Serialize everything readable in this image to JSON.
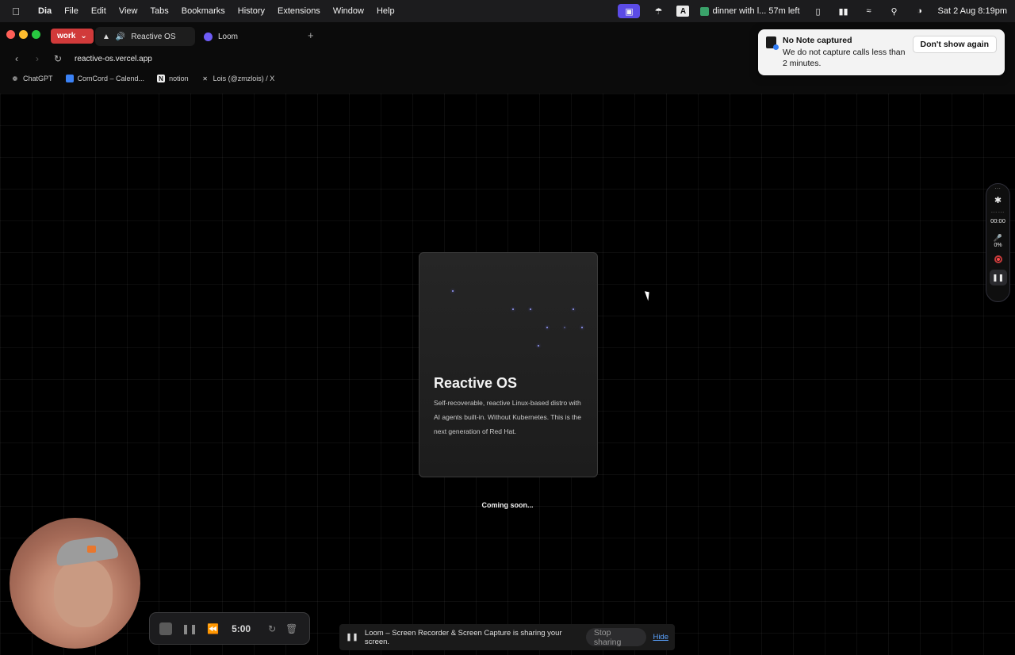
{
  "menubar": {
    "app_name": "Dia",
    "menus": [
      "File",
      "Edit",
      "View",
      "Tabs",
      "Bookmarks",
      "History",
      "Extensions",
      "Window",
      "Help"
    ],
    "calendar_event": "dinner with l... 57m left",
    "datetime": "Sat 2 Aug  8:19pm",
    "input_source": "A"
  },
  "browser": {
    "space": "work",
    "tabs": [
      {
        "title": "Reactive OS",
        "active": true
      },
      {
        "title": "Loom",
        "active": false
      }
    ],
    "new_tab": "+",
    "url": "reactive-os.vercel.app",
    "bookmarks": [
      "ChatGPT",
      "ComCord – Calend...",
      "notion",
      "Lois (@zmzlois) / X"
    ]
  },
  "page": {
    "card_title": "Reactive OS",
    "card_description": "Self-recoverable, reactive Linux-based distro with AI agents built-in. Without Kubernetes. This is the next generation of Red Hat.",
    "coming_soon": "Coming soon..."
  },
  "notification": {
    "title": "No Note captured",
    "body": "We do not capture calls less than 2 minutes.",
    "button": "Don't show again"
  },
  "loom_side": {
    "timer": "00:00",
    "mic_level": "0%"
  },
  "loom_toolbar": {
    "time": "5:00"
  },
  "share_bar": {
    "message": "Loom – Screen Recorder & Screen Capture is sharing your screen.",
    "stop_button": "Stop sharing",
    "hide_link": "Hide"
  },
  "colors": {
    "space_badge": "#d13a3a",
    "loom_purple": "#6e5cf6",
    "record_red": "#ff4a4a",
    "link_blue": "#5aa2ff"
  }
}
